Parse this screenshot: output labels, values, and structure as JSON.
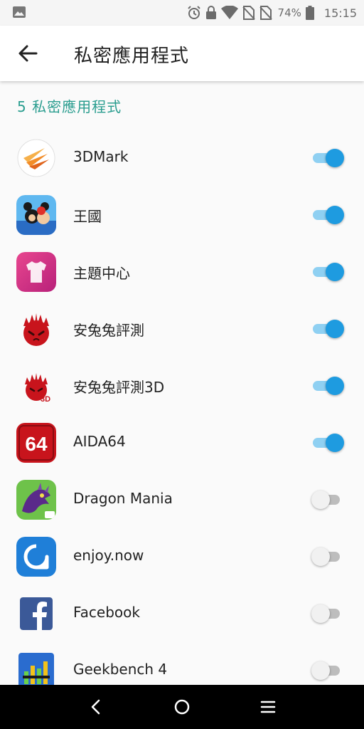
{
  "status_bar": {
    "battery_percent": "74%",
    "time": "15:15",
    "icons": [
      "image-icon",
      "alarm-icon",
      "lock-icon",
      "wifi-icon",
      "no-sim-icon",
      "no-sim-icon",
      "battery-icon"
    ]
  },
  "app_bar": {
    "title": "私密應用程式"
  },
  "section_header": "5 私密應用程式",
  "apps": [
    {
      "label": "3DMark",
      "enabled": true
    },
    {
      "label": "王國",
      "enabled": true
    },
    {
      "label": "主題中心",
      "enabled": true
    },
    {
      "label": "安兔兔評測",
      "enabled": true
    },
    {
      "label": "安兔兔評測3D",
      "enabled": true
    },
    {
      "label": "AIDA64",
      "enabled": true
    },
    {
      "label": "Dragon Mania",
      "enabled": false
    },
    {
      "label": "enjoy.now",
      "enabled": false
    },
    {
      "label": "Facebook",
      "enabled": false
    },
    {
      "label": "Geekbench 4",
      "enabled": false
    }
  ],
  "colors": {
    "accent": "#1e9be0",
    "section_header": "#2a9d8f"
  }
}
